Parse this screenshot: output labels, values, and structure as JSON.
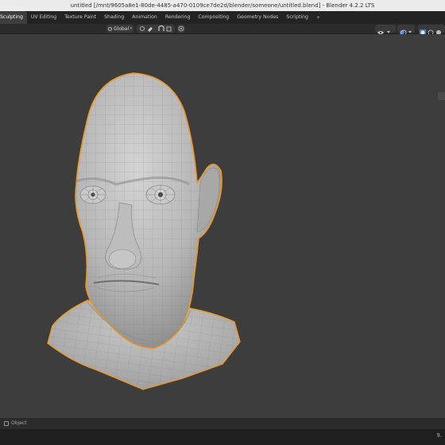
{
  "window": {
    "title": "untitled [/mnt/9605a8e1-80de-4485-a470-0109ce7de2d/blender/someone/untitled.blend] - Blender 4.2.2 LTS"
  },
  "workspace_tabs": [
    {
      "label": "Sculpting",
      "active": true
    },
    {
      "label": "UV Editing",
      "active": false
    },
    {
      "label": "Texture Paint",
      "active": false
    },
    {
      "label": "Shading",
      "active": false
    },
    {
      "label": "Animation",
      "active": false
    },
    {
      "label": "Rendering",
      "active": false
    },
    {
      "label": "Compositing",
      "active": false
    },
    {
      "label": "Geometry Nodes",
      "active": false
    },
    {
      "label": "Scripting",
      "active": false
    }
  ],
  "add_tab_label": "+",
  "viewport_header": {
    "transform_orientation": "Global"
  },
  "status_bar": {
    "mode_label": "Object"
  },
  "bottom": {
    "version_fragment": "9."
  },
  "colors": {
    "selection_outline": "#f0961e",
    "mesh_base": "#bdbdbd",
    "viewport_bg": "#3d3d3d"
  },
  "icons": [
    "object-mode-icon",
    "orientation-icon",
    "snap-icon",
    "proportional-edit-icon",
    "viewport-shading-icon",
    "overlay-icon",
    "gizmo-icon"
  ]
}
